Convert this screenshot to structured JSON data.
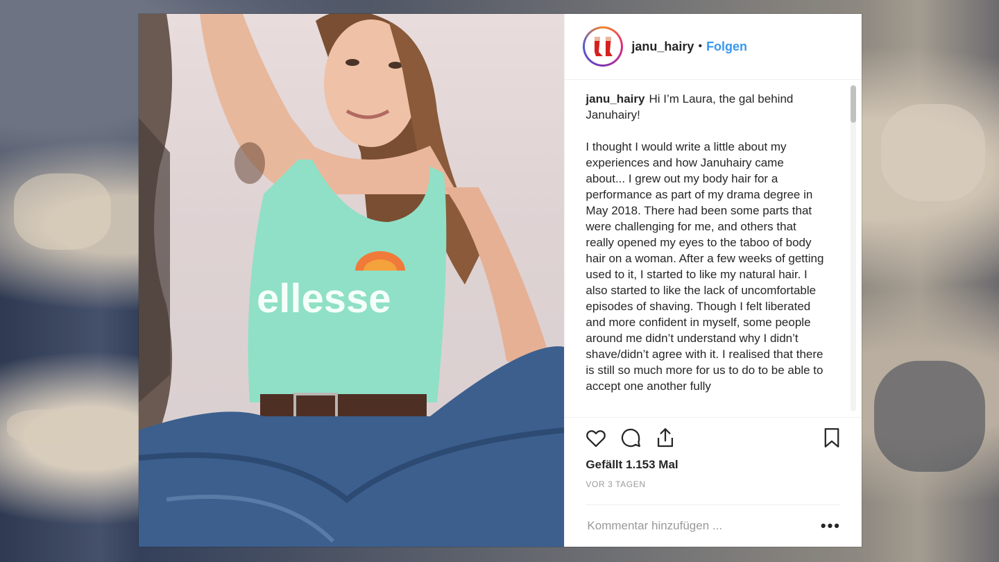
{
  "post": {
    "username": "janu_hairy",
    "separator": "•",
    "follow_label": "Folgen",
    "caption": {
      "username": "janu_hairy",
      "intro": "Hi I’m Laura, the gal behind Januhairy!",
      "body": "I thought I would write a little about my experiences and how Januhairy came about... I grew out my body hair for a performance as part of my drama degree in May 2018. There had been some parts that were challenging for me, and others that really opened my eyes to the taboo of body hair on a woman. After a few weeks of getting used to it, I started to like my natural hair. I also started to like the lack of uncomfortable episodes of shaving. Though I felt liberated and more confident in myself, some people around me didn’t understand why I didn’t shave/didn’t agree with it. I realised that there is still so much more for us to do to be able to accept one another fully"
    },
    "likes": "Gefällt 1.153 Mal",
    "time": "VOR 3 TAGEN",
    "comment_placeholder": "Kommentar hinzufügen ...",
    "more_label": "•••",
    "photo": {
      "shirt_text": "ellesse"
    }
  },
  "icons": {
    "like": "heart-icon",
    "comment": "comment-bubble-icon",
    "share": "share-icon",
    "save": "bookmark-icon"
  },
  "colors": {
    "link": "#3897f0",
    "text": "#262626",
    "muted": "#999999",
    "shirt": "#8fe0c6",
    "jeans": "#3c5f8e"
  }
}
